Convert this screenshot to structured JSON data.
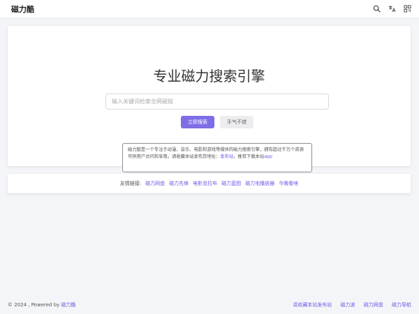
{
  "header": {
    "logo": "磁力酷",
    "icons": [
      "search-icon",
      "translate-icon",
      "qr-code-icon"
    ]
  },
  "hero": {
    "title": "专业磁力搜索引擎",
    "search_placeholder": "输入关键词检索全网磁链",
    "search_button": "立即搜索",
    "lucky_button": "手气不错",
    "intro": {
      "text": "磁力酷是一个专注于动漫、音乐、电影和游戏等媒体的磁力搜索引擎，拥有超过千万个资源可供用户访问和享用。请收藏本站发布页地址：",
      "link_publish": "发布站",
      "text_mid": "，推荐下载本站",
      "link_app": "app"
    }
  },
  "friend_links": {
    "label": "友情链接:",
    "items": [
      "磁力网盘",
      "磁力先锋",
      "电影克拉布",
      "磁力蓝图",
      "磁力宅播放器",
      "今晚看啥"
    ]
  },
  "footer": {
    "copyright": "© 2024 , Powered by ",
    "powered_link": "磁力酷",
    "links": [
      "请收藏本站发布站",
      "磁力波",
      "磁力网盘",
      "磁力导航"
    ]
  },
  "colors": {
    "accent": "#7e6ee6",
    "link": "#6c5ce7",
    "background": "#f4f5f8"
  }
}
